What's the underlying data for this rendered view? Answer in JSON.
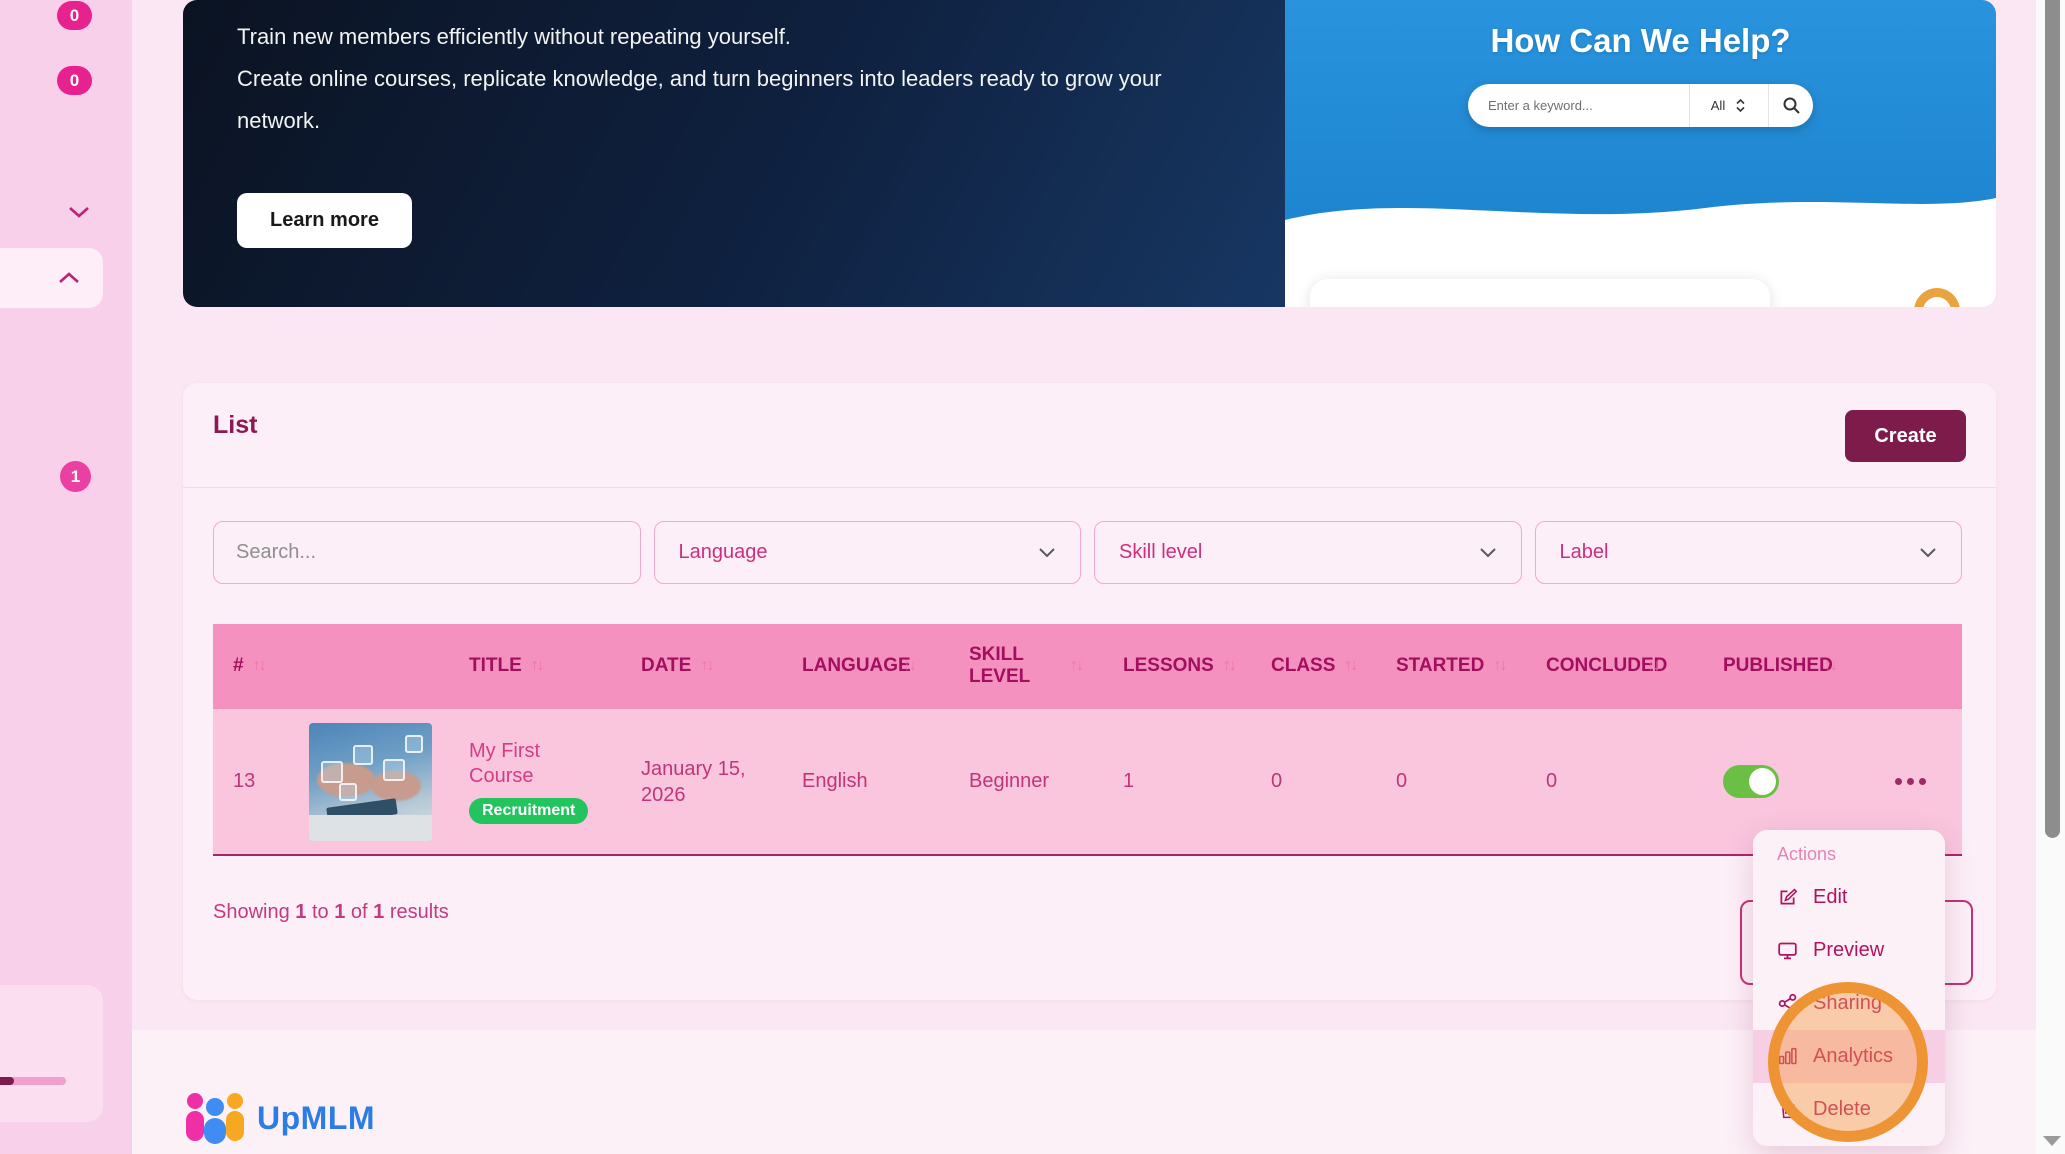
{
  "sidebar": {
    "badge_top": "0",
    "badge_second": "0",
    "badge_third": "1"
  },
  "banner": {
    "line1": "Train new members efficiently without repeating yourself.",
    "line2": "Create online courses, replicate knowledge, and turn beginners into leaders ready to grow your network.",
    "learn_more": "Learn more",
    "help": {
      "title": "How Can We Help?",
      "search_placeholder": "Enter a keyword...",
      "filter": "All"
    }
  },
  "list": {
    "title": "List",
    "create_label": "Create",
    "filters": {
      "search_placeholder": "Search...",
      "language": "Language",
      "skill_level": "Skill level",
      "label": "Label"
    },
    "table": {
      "columns": [
        "#",
        "TITLE",
        "DATE",
        "LANGUAGE",
        "SKILL LEVEL",
        "LESSONS",
        "CLASS",
        "STARTED",
        "CONCLUDED",
        "PUBLISHED"
      ],
      "row": {
        "id": "13",
        "title": "My First Course",
        "label": "Recruitment",
        "date": "January 15, 2026",
        "language": "English",
        "skill_level": "Beginner",
        "lessons": "1",
        "class": "0",
        "started": "0",
        "concluded": "0",
        "published": true
      }
    },
    "summary": {
      "showing": "Showing",
      "from": "1",
      "to_word": "to",
      "upto": "1",
      "of_word": "of",
      "total": "1",
      "results_word": "results"
    }
  },
  "actions_menu": {
    "label": "Actions",
    "items": [
      "Edit",
      "Preview",
      "Sharing",
      "Analytics",
      "Delete"
    ]
  },
  "footer": {
    "brand": "UpMLM"
  },
  "colors": {
    "accent": "#7d1c4b",
    "toggle_on": "#6cbf45",
    "label_green": "#23c45e",
    "annotation_orange": "#ef9434",
    "brand_blue": "#2c7ce6",
    "table_header_pink": "#f491bf"
  }
}
